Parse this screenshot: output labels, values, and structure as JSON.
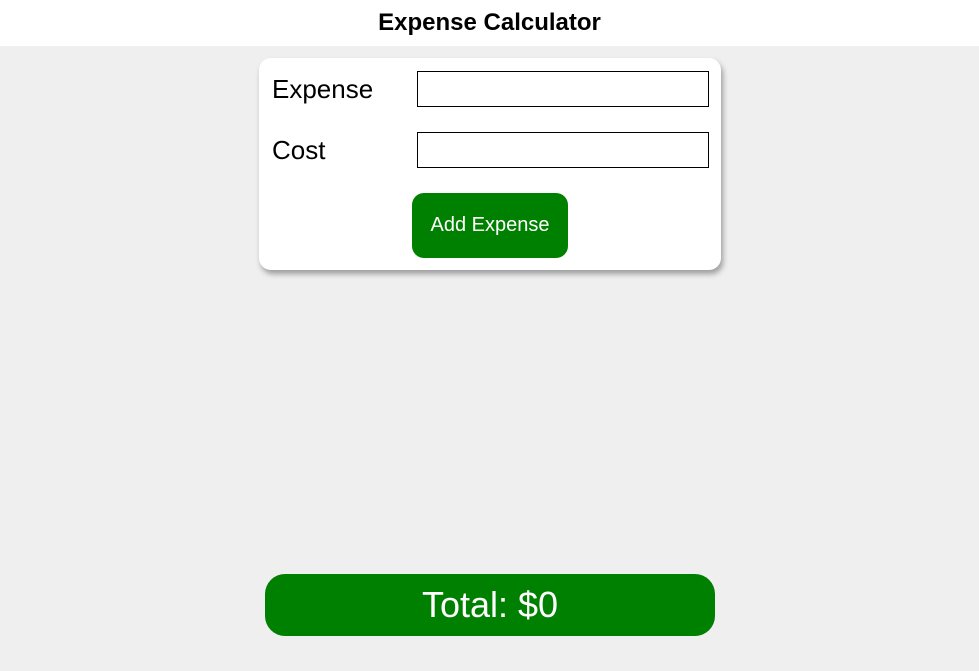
{
  "header": {
    "title": "Expense Calculator"
  },
  "form": {
    "expense_label": "Expense",
    "expense_value": "",
    "cost_label": "Cost",
    "cost_value": "",
    "add_button_label": "Add Expense"
  },
  "summary": {
    "total_text": "Total: $0"
  },
  "colors": {
    "accent": "#008000",
    "background": "#efefef",
    "card": "#ffffff"
  }
}
